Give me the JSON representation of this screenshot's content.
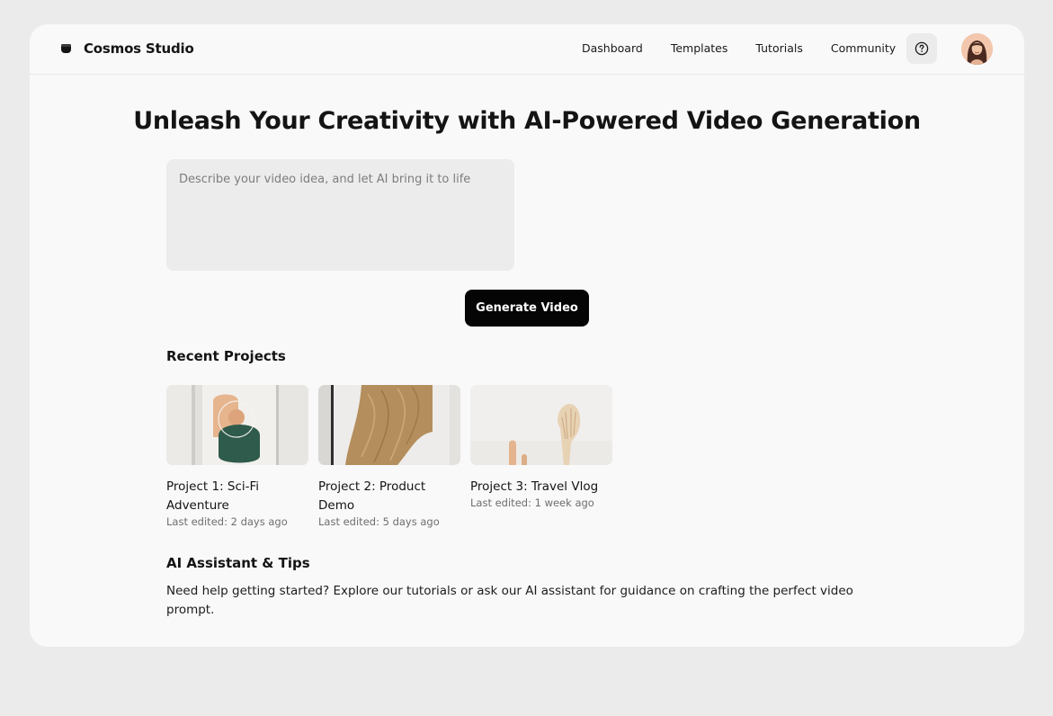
{
  "app": {
    "brand": "Cosmos Studio",
    "brand_icon": "database-icon"
  },
  "nav": {
    "items": [
      "Dashboard",
      "Templates",
      "Tutorials",
      "Community"
    ],
    "help_icon": "question-circle-icon"
  },
  "hero": {
    "title": "Unleash Your Creativity with AI-Powered Video Generation",
    "prompt_placeholder": "Describe your video idea, and let AI bring it to life",
    "prompt_value": "",
    "generate_label": "Generate Video"
  },
  "recent": {
    "heading": "Recent Projects",
    "projects": [
      {
        "title": "Project 1: Sci-Fi Adventure",
        "meta": "Last edited: 2 days ago"
      },
      {
        "title": "Project 2: Product Demo",
        "meta": "Last edited: 5 days ago"
      },
      {
        "title": "Project 3: Travel Vlog",
        "meta": "Last edited: 1 week ago"
      }
    ]
  },
  "tips": {
    "heading": "AI Assistant & Tips",
    "text": "Need help getting started? Explore our tutorials or ask our AI assistant for guidance on crafting the perfect video prompt."
  },
  "colors": {
    "background": "#ebebeb",
    "surface": "#f9f9f9",
    "input": "#ececec",
    "primary_button": "#050505",
    "muted_text": "#6e6e6e"
  }
}
